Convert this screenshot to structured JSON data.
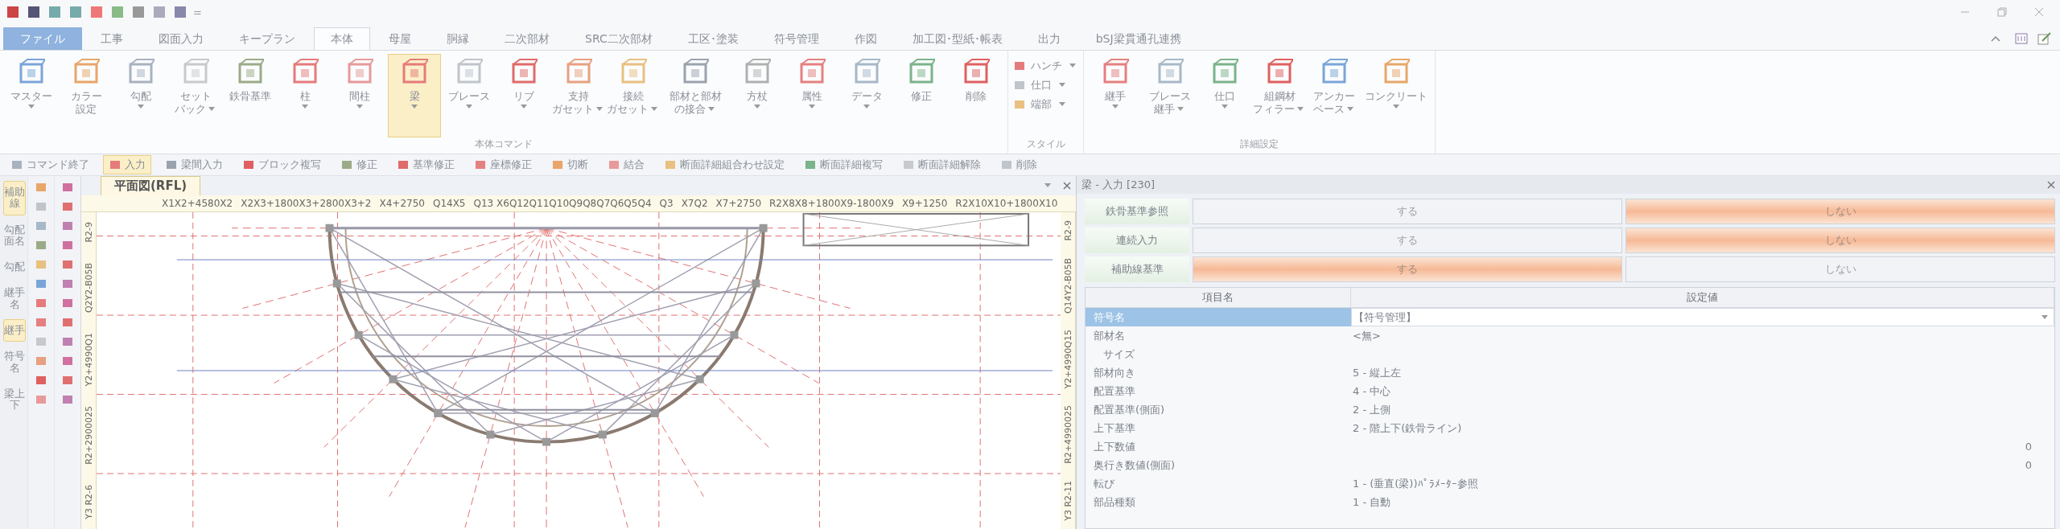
{
  "quick_access": {
    "separator": "="
  },
  "menu_tabs": [
    {
      "label": "ファイル",
      "kind": "file",
      "selected": false
    },
    {
      "label": "工事",
      "kind": "tab",
      "selected": false
    },
    {
      "label": "図面入力",
      "kind": "tab",
      "selected": false
    },
    {
      "label": "キープラン",
      "kind": "tab",
      "selected": false
    },
    {
      "label": "本体",
      "kind": "tab",
      "selected": true
    },
    {
      "label": "母屋",
      "kind": "tab",
      "selected": false
    },
    {
      "label": "胴縁",
      "kind": "tab",
      "selected": false
    },
    {
      "label": "二次部材",
      "kind": "tab",
      "selected": false
    },
    {
      "label": "SRC二次部材",
      "kind": "tab",
      "selected": false
    },
    {
      "label": "工区･塗装",
      "kind": "tab",
      "selected": false
    },
    {
      "label": "符号管理",
      "kind": "tab",
      "selected": false
    },
    {
      "label": "作図",
      "kind": "tab",
      "selected": false
    },
    {
      "label": "加工図･型紙･帳表",
      "kind": "tab",
      "selected": false
    },
    {
      "label": "出力",
      "kind": "tab",
      "selected": false
    },
    {
      "label": "bSJ梁貫通孔連携",
      "kind": "tab",
      "selected": false
    }
  ],
  "ribbon_groups": [
    {
      "title": "本体コマンド",
      "kind": "large",
      "buttons": [
        {
          "lines": [
            "マスター"
          ],
          "dropdown": true,
          "selected": false
        },
        {
          "lines": [
            "カラー",
            "設定"
          ],
          "dropdown": false,
          "selected": false
        },
        {
          "lines": [
            "勾配"
          ],
          "dropdown": true,
          "selected": false
        },
        {
          "lines": [
            "セット",
            "バック"
          ],
          "dropdown": true,
          "selected": false
        },
        {
          "lines": [
            "鉄骨基準"
          ],
          "dropdown": false,
          "selected": false
        },
        {
          "lines": [
            "柱"
          ],
          "dropdown": true,
          "selected": false
        },
        {
          "lines": [
            "間柱"
          ],
          "dropdown": true,
          "selected": false
        },
        {
          "lines": [
            "梁"
          ],
          "dropdown": true,
          "selected": true
        },
        {
          "lines": [
            "ブレース"
          ],
          "dropdown": true,
          "selected": false
        },
        {
          "lines": [
            "リブ"
          ],
          "dropdown": true,
          "selected": false
        },
        {
          "lines": [
            "支持",
            "ガセット"
          ],
          "dropdown": true,
          "selected": false
        },
        {
          "lines": [
            "接続",
            "ガセット"
          ],
          "dropdown": true,
          "selected": false
        },
        {
          "lines": [
            "部材と部材",
            "の接合"
          ],
          "dropdown": true,
          "selected": false
        },
        {
          "lines": [
            "方杖"
          ],
          "dropdown": true,
          "selected": false
        },
        {
          "lines": [
            "属性"
          ],
          "dropdown": true,
          "selected": false
        },
        {
          "lines": [
            "データ"
          ],
          "dropdown": true,
          "selected": false
        },
        {
          "lines": [
            "修正"
          ],
          "dropdown": false,
          "selected": false
        },
        {
          "lines": [
            "削除"
          ],
          "dropdown": false,
          "selected": false
        }
      ]
    },
    {
      "title": "スタイル",
      "kind": "small",
      "buttons": [
        {
          "lines": [
            "ハンチ"
          ],
          "dropdown": true,
          "selected": false
        },
        {
          "lines": [
            "仕口"
          ],
          "dropdown": true,
          "selected": false
        },
        {
          "lines": [
            "端部"
          ],
          "dropdown": true,
          "selected": false
        }
      ]
    },
    {
      "title": "詳細設定",
      "kind": "large",
      "buttons": [
        {
          "lines": [
            "継手"
          ],
          "dropdown": true,
          "selected": false
        },
        {
          "lines": [
            "ブレース",
            "継手"
          ],
          "dropdown": true,
          "selected": false
        },
        {
          "lines": [
            "仕口"
          ],
          "dropdown": true,
          "selected": false
        },
        {
          "lines": [
            "組鋼材",
            "フィラー"
          ],
          "dropdown": true,
          "selected": false
        },
        {
          "lines": [
            "アンカー",
            "ベース"
          ],
          "dropdown": true,
          "selected": false
        },
        {
          "lines": [
            "コンクリート"
          ],
          "dropdown": true,
          "selected": false
        }
      ]
    }
  ],
  "command_bar": [
    {
      "label": "コマンド終了",
      "selected": false
    },
    {
      "label": "入力",
      "selected": true
    },
    {
      "label": "梁間入力",
      "selected": false
    },
    {
      "label": "ブロック複写",
      "selected": false
    },
    {
      "label": "修正",
      "selected": false
    },
    {
      "label": "基準修正",
      "selected": false
    },
    {
      "label": "座標修正",
      "selected": false
    },
    {
      "label": "切断",
      "selected": false
    },
    {
      "label": "結合",
      "selected": false
    },
    {
      "label": "断面詳細組合わせ設定",
      "selected": false
    },
    {
      "label": "断面詳細複写",
      "selected": false
    },
    {
      "label": "断面詳細解除",
      "selected": false
    },
    {
      "label": "削除",
      "selected": false
    }
  ],
  "side_tabs": [
    {
      "label": "補助線",
      "selected": true
    },
    {
      "label": "勾配面名",
      "selected": false
    },
    {
      "label": "勾配",
      "selected": false
    },
    {
      "label": "継手名",
      "selected": false
    },
    {
      "label": "継手",
      "selected": true
    },
    {
      "label": "符号名",
      "selected": false
    },
    {
      "label": "梁上下",
      "selected": false
    }
  ],
  "drawing_window": {
    "tab": "平面図(RFL)",
    "top_ruler": [
      "X1X2+4580X2",
      "X2X3+1800X3+2800X3+2",
      "X4+2750",
      "Q14X5",
      "Q13 X6Q12Q11Q10Q9Q8Q7Q6Q5Q4",
      "Q3",
      "X7Q2",
      "X7+2750",
      "R2X8X8+1800X9-1800X9",
      "X9+1250",
      "R2X10X10+1800X10"
    ],
    "left_ruler": [
      "Y3 R2-6",
      "R2+2900025",
      "Y2+4990Q1",
      "Q2Y2-B05B",
      "R2-9"
    ],
    "right_ruler": [
      "Y3 R2-11",
      "R2+4990025",
      "Y2+4990Q15",
      "Q14Y2-B05B",
      "R2-9"
    ]
  },
  "input_panel": {
    "title": "梁 - 入力 [230]",
    "toggles": [
      {
        "label": "鉄骨基準参照",
        "options": [
          {
            "label": "する",
            "selected": false
          },
          {
            "label": "しない",
            "selected": true
          }
        ]
      },
      {
        "label": "連続入力",
        "options": [
          {
            "label": "する",
            "selected": false
          },
          {
            "label": "しない",
            "selected": true
          }
        ]
      },
      {
        "label": "補助線基準",
        "options": [
          {
            "label": "する",
            "selected": true
          },
          {
            "label": "しない",
            "selected": false
          }
        ]
      }
    ],
    "columns": [
      "項目名",
      "設定値"
    ],
    "rows": [
      {
        "name": "符号名",
        "value": "【符号管理】",
        "kind": "dropdown",
        "selected": true
      },
      {
        "name": "部材名",
        "value": "<無>",
        "kind": "text",
        "selected": false
      },
      {
        "name": "サイズ",
        "value": "",
        "kind": "sub",
        "selected": false
      },
      {
        "name": "部材向き",
        "value": "5 - 縦上左",
        "kind": "text",
        "selected": false
      },
      {
        "name": "配置基準",
        "value": "4 - 中心",
        "kind": "text",
        "selected": false
      },
      {
        "name": "配置基準(側面)",
        "value": "2 - 上側",
        "kind": "text",
        "selected": false
      },
      {
        "name": "上下基準",
        "value": "2 - 階上下(鉄骨ライン)",
        "kind": "text",
        "selected": false
      },
      {
        "name": "上下数値",
        "value": "0",
        "kind": "number",
        "selected": false
      },
      {
        "name": "奥行き数値(側面)",
        "value": "0",
        "kind": "number",
        "selected": false
      },
      {
        "name": "転び",
        "value": "1 - (垂直(梁))ﾊﾟﾗﾒｰﾀｰ参照",
        "kind": "text",
        "selected": false
      },
      {
        "name": "部品種類",
        "value": "1 - 自動",
        "kind": "text",
        "selected": false
      }
    ]
  }
}
